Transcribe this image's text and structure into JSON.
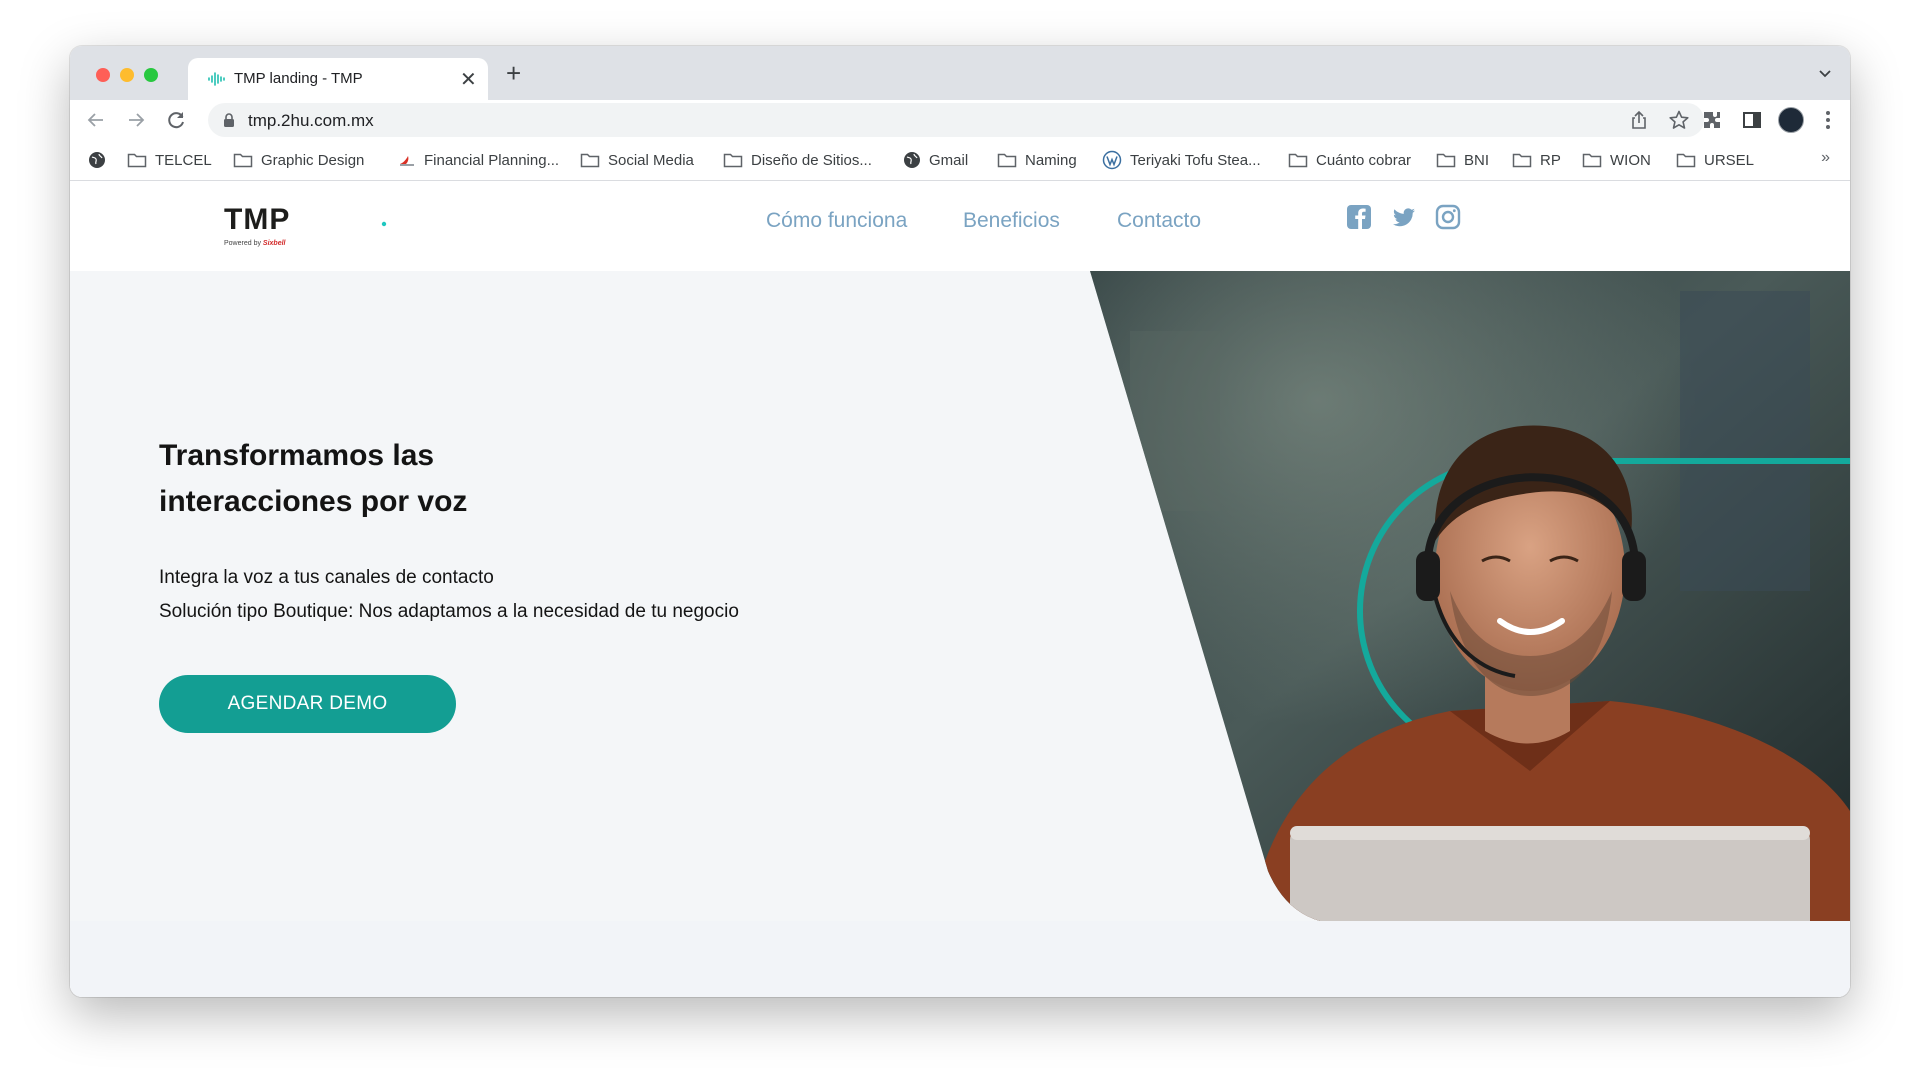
{
  "browser": {
    "tab": {
      "title": "TMP landing - TMP"
    },
    "address": {
      "url": "tmp.2hu.com.mx"
    },
    "bookmarks": [
      {
        "label": "",
        "icon": "globe-icon"
      },
      {
        "label": "TELCEL",
        "icon": "folder-icon"
      },
      {
        "label": "Graphic Design",
        "icon": "folder-icon"
      },
      {
        "label": "Financial Planning...",
        "icon": "site-favicon-icon"
      },
      {
        "label": "Social Media",
        "icon": "folder-icon"
      },
      {
        "label": "Diseño de Sitios...",
        "icon": "folder-icon"
      },
      {
        "label": "Gmail",
        "icon": "globe-icon"
      },
      {
        "label": "Naming",
        "icon": "folder-icon"
      },
      {
        "label": "Teriyaki Tofu Stea...",
        "icon": "wordpress-icon"
      },
      {
        "label": "Cuánto cobrar",
        "icon": "folder-icon"
      },
      {
        "label": "BNI",
        "icon": "folder-icon"
      },
      {
        "label": "RP",
        "icon": "folder-icon"
      },
      {
        "label": "WION",
        "icon": "folder-icon"
      },
      {
        "label": "URSEL",
        "icon": "folder-icon"
      }
    ],
    "bookmarks_overflow": "»"
  },
  "site": {
    "logo": {
      "text": "TMP",
      "powered": "Powered by",
      "brand": "Sixbell"
    },
    "nav": [
      {
        "label": "Cómo funciona"
      },
      {
        "label": "Beneficios"
      },
      {
        "label": "Contacto"
      }
    ],
    "social": [
      "facebook-icon",
      "twitter-icon",
      "instagram-icon"
    ],
    "hero": {
      "title_line1": "Transformamos las",
      "title_line2": "interacciones por voz",
      "sub_line1": "Integra la voz a tus canales de contacto",
      "sub_line2": "Solución tipo Boutique: Nos adaptamos a la necesidad de tu negocio",
      "cta_label": "AGENDAR DEMO"
    }
  },
  "colors": {
    "accent": "#139e93",
    "nav_link": "#7aa3c2",
    "hero_bg": "#f4f6f8",
    "text": "#141414"
  }
}
